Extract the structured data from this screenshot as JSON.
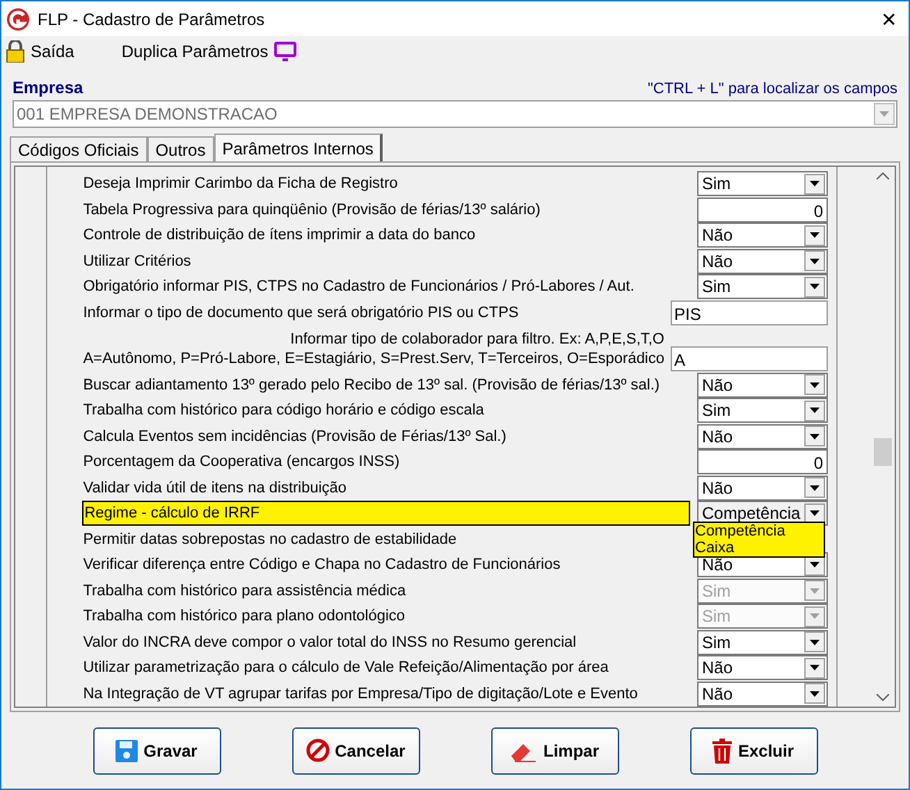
{
  "window": {
    "title": "FLP - Cadastro de Parâmetros",
    "close": "✕"
  },
  "menu": [
    {
      "label": "Saída",
      "kind": "lock"
    },
    {
      "label": "Duplica Parâmetros",
      "kind": "monitor"
    }
  ],
  "empresa": {
    "label": "Empresa",
    "hint": "\"CTRL + L\" para localizar os campos",
    "value": "001 EMPRESA DEMONSTRACAO"
  },
  "tabs": [
    {
      "label": "Códigos Oficiais",
      "selected": false
    },
    {
      "label": "Outros",
      "selected": false
    },
    {
      "label": "Parâmetros Internos",
      "selected": true
    }
  ],
  "parameters": [
    {
      "label": "Deseja Imprimir Carimbo da Ficha de Registro",
      "kind": "combo",
      "value": "Sim",
      "disabled": false,
      "highlighted": false
    },
    {
      "label": "Tabela Progressiva para quinqüênio (Provisão de férias/13º salário)",
      "kind": "number",
      "value": "0",
      "disabled": false,
      "highlighted": false
    },
    {
      "label": "Controle de distribuição de ítens imprimir a data do banco",
      "kind": "combo",
      "value": "Não",
      "disabled": false,
      "highlighted": false
    },
    {
      "label": "Utilizar Critérios",
      "kind": "combo",
      "value": "Não",
      "disabled": false,
      "highlighted": false
    },
    {
      "label": "Obrigatório informar PIS, CTPS no Cadastro de Funcionários / Pró-Labores / Aut.",
      "kind": "combo",
      "value": "Sim",
      "disabled": false,
      "highlighted": false
    },
    {
      "label": "Informar o tipo de documento que será obrigatório PIS ou CTPS",
      "kind": "text",
      "value": "PIS",
      "disabled": false,
      "highlighted": false
    },
    {
      "label": "Informar tipo de colaborador para filtro. Ex: A,P,E,S,T,O",
      "label_2": "A=Autônomo, P=Pró-Labore, E=Estagiário, S=Prest.Serv, T=Terceiros, O=Esporádico",
      "kind": "text",
      "value": "A",
      "disabled": false,
      "highlighted": false
    },
    {
      "label": "Buscar adiantamento 13º  gerado pelo Recibo de 13º sal. (Provisão de férias/13º sal.)",
      "kind": "combo",
      "value": "Não",
      "disabled": false,
      "highlighted": false
    },
    {
      "label": "Trabalha com histórico para código horário e código escala",
      "kind": "combo",
      "value": "Sim",
      "disabled": false,
      "highlighted": false
    },
    {
      "label": "Calcula Eventos sem incidências (Provisão de Férias/13º Sal.)",
      "kind": "combo",
      "value": "Não",
      "disabled": false,
      "highlighted": false
    },
    {
      "label": "Porcentagem da Cooperativa (encargos INSS)",
      "kind": "number",
      "value": "0",
      "disabled": false,
      "highlighted": false
    },
    {
      "label": "Validar vida útil de itens na distribuição",
      "kind": "combo",
      "value": "Não",
      "disabled": false,
      "highlighted": false
    },
    {
      "label": "Regime - cálculo de IRRF",
      "kind": "combo",
      "value": "Competência",
      "disabled": false,
      "highlighted": true,
      "options": [
        "Competência",
        "Caixa"
      ]
    },
    {
      "label": "Permitir datas sobrepostas no cadastro de estabilidade",
      "kind": "none",
      "disabled": false,
      "highlighted": false
    },
    {
      "label": "Verificar diferença entre Código e Chapa no Cadastro de Funcionários",
      "kind": "combo",
      "value": "Não",
      "disabled": false,
      "highlighted": false
    },
    {
      "label": "Trabalha com histórico para assistência médica",
      "kind": "combo",
      "value": "Sim",
      "disabled": true,
      "highlighted": false
    },
    {
      "label": "Trabalha com histórico para plano odontológico",
      "kind": "combo",
      "value": "Sim",
      "disabled": true,
      "highlighted": false
    },
    {
      "label": "Valor do INCRA deve compor o valor total do INSS no Resumo gerencial",
      "kind": "combo",
      "value": "Sim",
      "disabled": false,
      "highlighted": false
    },
    {
      "label": "Utilizar parametrização para o cálculo de Vale Refeição/Alimentação por área",
      "kind": "combo",
      "value": "Não",
      "disabled": false,
      "highlighted": false
    },
    {
      "label": "Na Integração de VT agrupar tarifas por Empresa/Tipo de digitação/Lote e Evento",
      "kind": "combo",
      "value": "Não",
      "disabled": false,
      "highlighted": false
    }
  ],
  "buttons": [
    {
      "label": "Gravar",
      "kind": "save"
    },
    {
      "label": "Cancelar",
      "kind": "cancel"
    },
    {
      "label": "Limpar",
      "kind": "clear"
    },
    {
      "label": "Excluir",
      "kind": "delete"
    }
  ]
}
